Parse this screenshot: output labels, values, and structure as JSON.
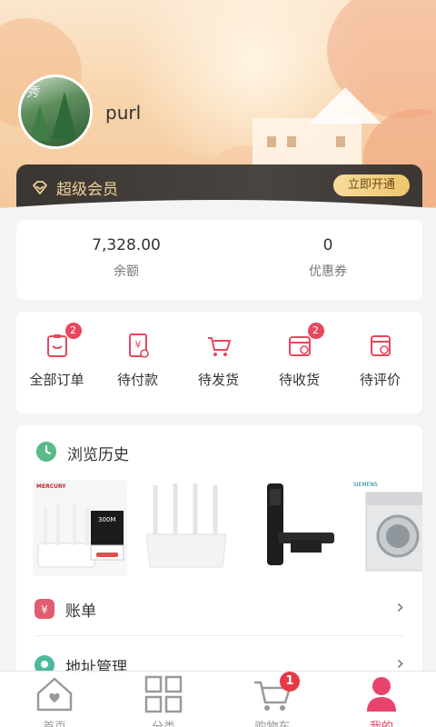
{
  "profile": {
    "username": "purl",
    "avatar_text": "秀"
  },
  "vip": {
    "label": "超级会员",
    "button": "立即开通"
  },
  "stats": [
    {
      "value": "7,328.00",
      "label": "余额"
    },
    {
      "value": "0",
      "label": "优惠券"
    }
  ],
  "orders": [
    {
      "label": "全部订单",
      "icon": "order-list-icon",
      "badge": "2"
    },
    {
      "label": "待付款",
      "icon": "payment-icon",
      "badge": ""
    },
    {
      "label": "待发货",
      "icon": "cart-ship-icon",
      "badge": ""
    },
    {
      "label": "待收货",
      "icon": "receive-box-icon",
      "badge": "2"
    },
    {
      "label": "待评价",
      "icon": "review-icon",
      "badge": ""
    }
  ],
  "history": {
    "title": "浏览历史",
    "items": [
      {
        "name": "mercury-router",
        "brand": "MERCURY",
        "caption": "300M"
      },
      {
        "name": "white-router",
        "brand": "",
        "caption": ""
      },
      {
        "name": "smart-door-lock",
        "brand": "",
        "caption": ""
      },
      {
        "name": "siemens-washer",
        "brand": "SIEMENS",
        "caption": ""
      }
    ]
  },
  "menu": [
    {
      "label": "账单",
      "icon": "bill-icon"
    },
    {
      "label": "地址管理",
      "icon": "address-icon"
    }
  ],
  "nav": [
    {
      "label": "首页",
      "icon": "home-icon"
    },
    {
      "label": "分类",
      "icon": "category-icon"
    },
    {
      "label": "购物车",
      "icon": "cart-icon",
      "badge": "1"
    },
    {
      "label": "我的",
      "icon": "profile-icon",
      "active": true
    }
  ],
  "colors": {
    "accent": "#e8436b",
    "gold": "#f0d29a",
    "badge": "#e6475d"
  }
}
